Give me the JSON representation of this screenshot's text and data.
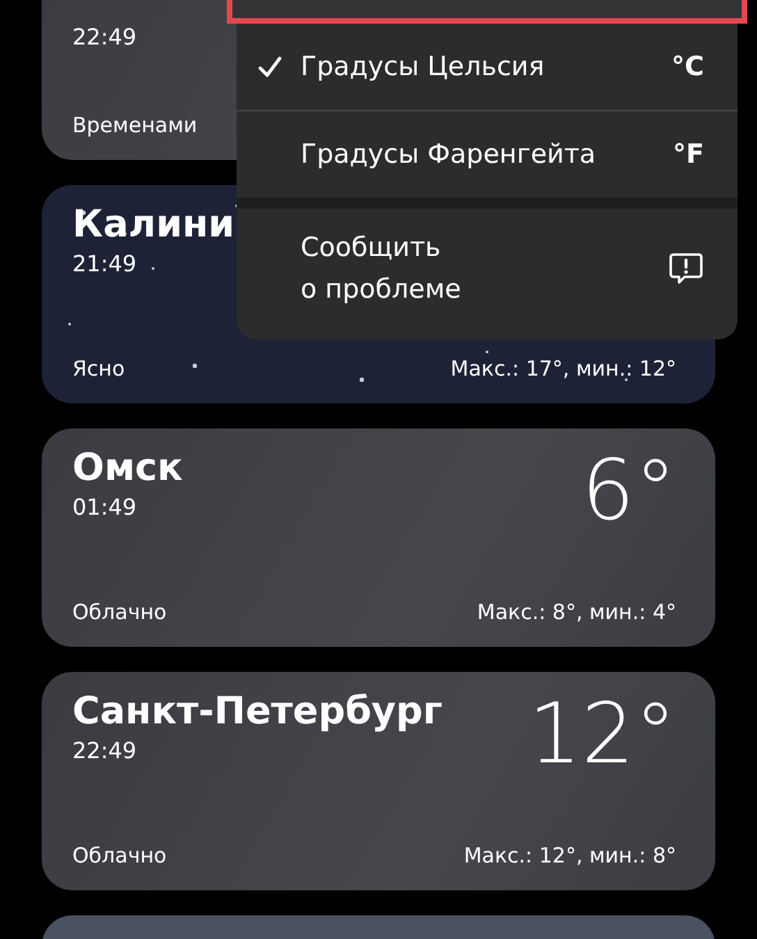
{
  "cities": [
    {
      "kind": "cloudy",
      "time": "22:49",
      "condition": "Временами"
    },
    {
      "kind": "night",
      "name": "Калини",
      "time": "21:49",
      "condition": "Ясно",
      "range": "Макс.: 17°, мин.: 12°"
    },
    {
      "kind": "cloudy",
      "name": "Омск",
      "time": "01:49",
      "condition": "Облачно",
      "temperature": "6°",
      "range": "Макс.: 8°, мин.: 4°"
    },
    {
      "kind": "cloudy",
      "name": "Санкт-Петербург",
      "time": "22:49",
      "condition": "Облачно",
      "temperature": "12°",
      "range": "Макс.: 12°, мин.: 8°"
    },
    {
      "kind": "blue"
    }
  ],
  "menu": {
    "items": [
      {
        "kind": "option",
        "label": "Градусы Цельсия",
        "symbol": "°C",
        "selected": true
      },
      {
        "kind": "option",
        "label": "Градусы Фаренгейта",
        "symbol": "°F",
        "selected": false
      },
      {
        "kind": "action",
        "label": "Сообщить\nо проблеме"
      }
    ]
  }
}
